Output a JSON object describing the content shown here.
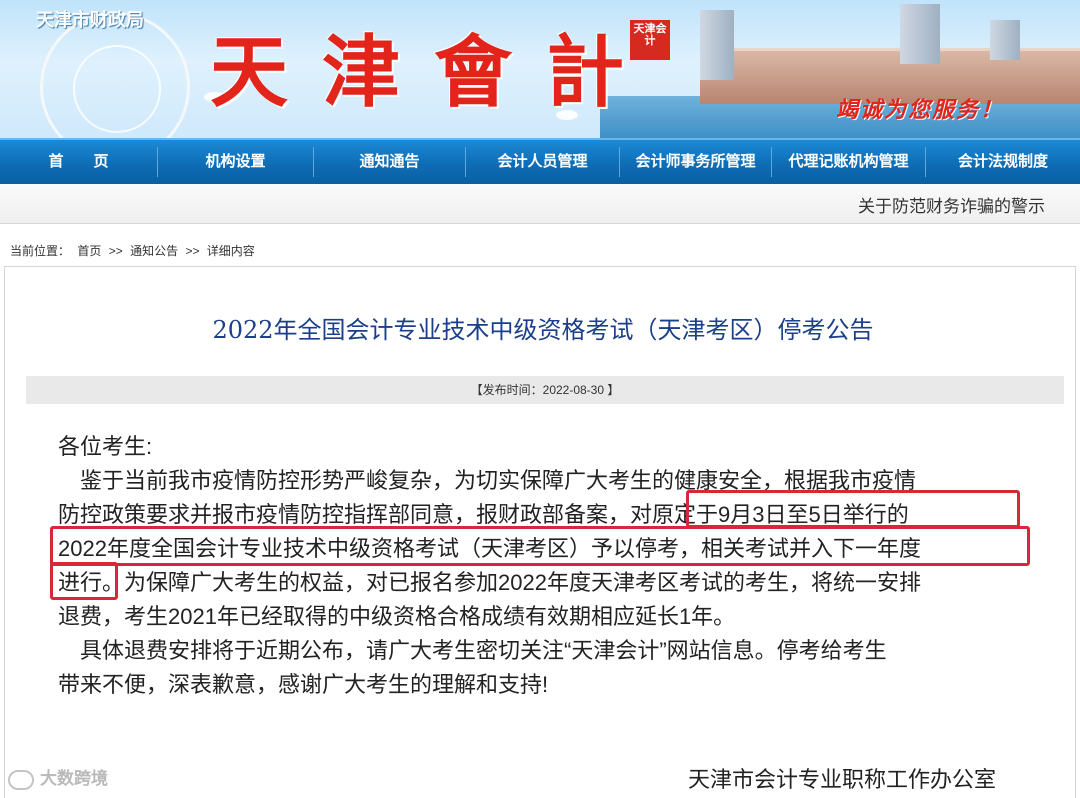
{
  "banner": {
    "bureau": "天津市财政局",
    "title": "天津會計",
    "seal": "天津会计",
    "slogan": "竭诚为您服务！"
  },
  "nav": {
    "items": [
      "首　　页",
      "机构设置",
      "通知通告",
      "会计人员管理",
      "会计师事务所管理",
      "代理记账机构管理",
      "会计法规制度"
    ]
  },
  "marquee": {
    "text": "关于防范财务诈骗的警示"
  },
  "breadcrumb": {
    "prefix": "当前位置：",
    "home": "首页",
    "sep1": ">>",
    "notices": "通知公告",
    "sep2": ">>",
    "detail": "详细内容"
  },
  "article": {
    "title": "2022年全国会计专业技术中级资格考试（天津考区）停考公告",
    "publish": "【发布时间：2022-08-30 】",
    "lines": [
      "各位考生:",
      "　鉴于当前我市疫情防控形势严峻复杂，为切实保障广大考生的健康安全，根据我市疫情",
      "防控政策要求并报市疫情防控指挥部同意，报财政部备案，对原定于9月3日至5日举行的",
      "2022年度全国会计专业技术中级资格考试（天津考区）予以停考，相关考试并入下一年度",
      "进行。为保障广大考生的权益，对已报名参加2022年度天津考区考试的考生，将统一安排",
      "退费，考生2021年已经取得的中级资格合格成绩有效期相应延长1年。",
      "　具体退费安排将于近期公布，请广大考生密切关注“天津会计”网站信息。停考给考生",
      "带来不便，深表歉意，感谢广大考生的理解和支持!"
    ],
    "signature": "天津市会计专业职称工作办公室"
  },
  "watermark": {
    "text": "大数跨境"
  },
  "colors": {
    "nav": "#0e6db5",
    "title": "#1b3f8a",
    "highlight": "#d7283a",
    "banner_title": "#e3241b"
  }
}
